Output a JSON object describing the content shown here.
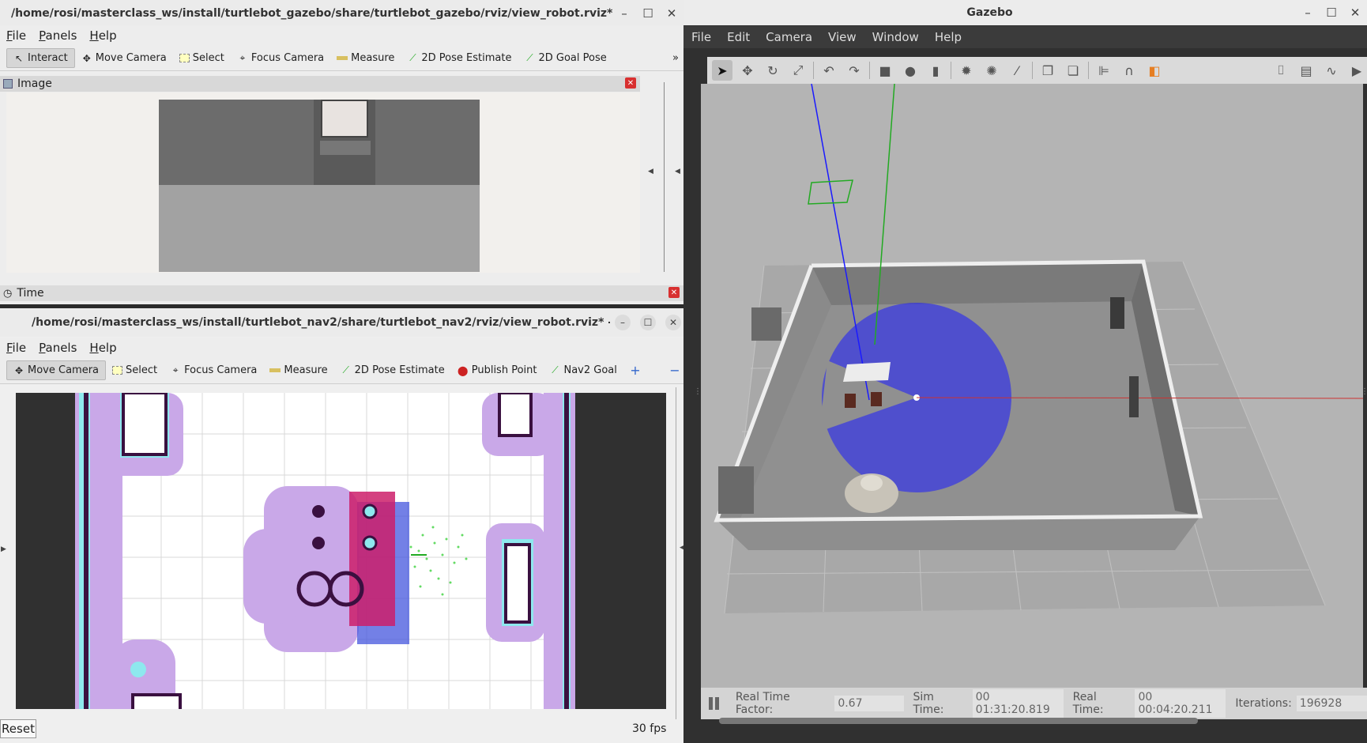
{
  "rviz_top": {
    "title": "/home/rosi/masterclass_ws/install/turtlebot_gazebo/share/turtlebot_gazebo/rviz/view_robot.rviz* - RViz",
    "menu": [
      "File",
      "Panels",
      "Help"
    ],
    "tools": [
      {
        "label": "Interact",
        "icon": "cursor-icon"
      },
      {
        "label": "Move Camera",
        "icon": "move-icon"
      },
      {
        "label": "Select",
        "icon": "select-icon"
      },
      {
        "label": "Focus Camera",
        "icon": "focus-icon"
      },
      {
        "label": "Measure",
        "icon": "ruler-icon"
      },
      {
        "label": "2D Pose Estimate",
        "icon": "arrow-green-icon"
      },
      {
        "label": "2D Goal Pose",
        "icon": "arrow-green-icon"
      }
    ],
    "overflow": "»",
    "image_panel_title": "Image",
    "time_panel_title": "Time"
  },
  "rviz_bottom": {
    "title": "/home/rosi/masterclass_ws/install/turtlebot_nav2/share/turtlebot_nav2/rviz/view_robot.rviz* - RViz",
    "menu": [
      "File",
      "Panels",
      "Help"
    ],
    "tools": [
      {
        "label": "Move Camera",
        "icon": "move-icon"
      },
      {
        "label": "Select",
        "icon": "select-icon"
      },
      {
        "label": "Focus Camera",
        "icon": "focus-icon"
      },
      {
        "label": "Measure",
        "icon": "ruler-icon"
      },
      {
        "label": "2D Pose Estimate",
        "icon": "arrow-green-icon"
      },
      {
        "label": "Publish Point",
        "icon": "pin-icon"
      },
      {
        "label": "Nav2 Goal",
        "icon": "arrow-green-icon"
      }
    ],
    "reset_label": "Reset",
    "fps": "30 fps"
  },
  "gazebo": {
    "title": "Gazebo",
    "menu": [
      "File",
      "Edit",
      "Camera",
      "View",
      "Window",
      "Help"
    ],
    "status": {
      "rtf_label": "Real Time Factor:",
      "rtf_value": "0.67",
      "sim_label": "Sim Time:",
      "sim_value": "00 01:31:20.819",
      "real_label": "Real Time:",
      "real_value": "00 00:04:20.211",
      "iter_label": "Iterations:",
      "iter_value": "196928"
    }
  },
  "colors": {
    "scan_blue": "#1a1aff",
    "costmap_purple": "#c9a8e8",
    "pose_green": "#22cc22"
  }
}
